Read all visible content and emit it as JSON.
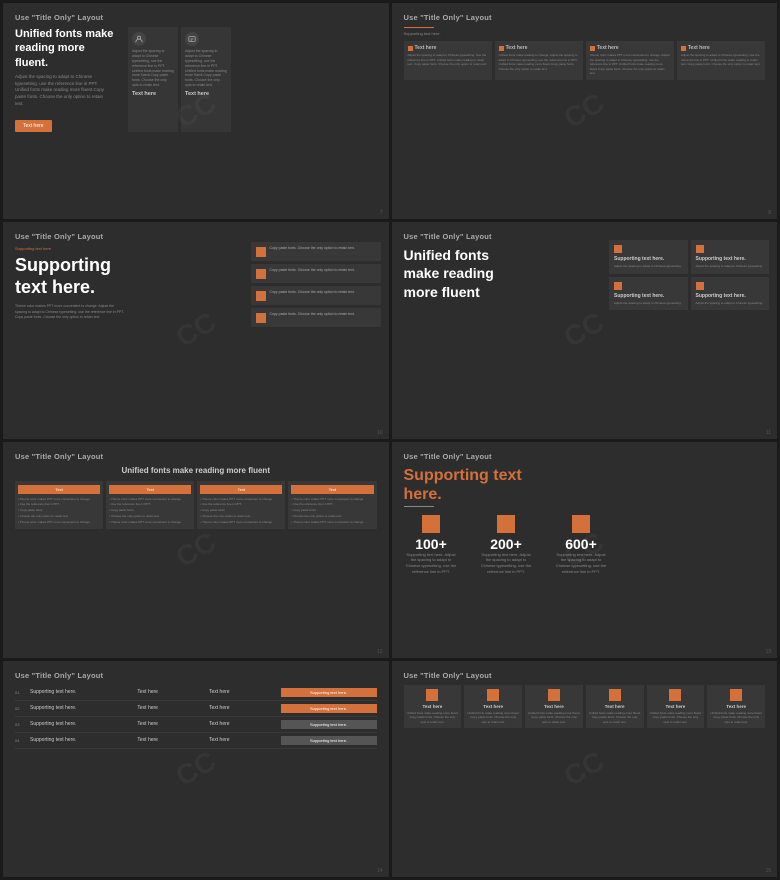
{
  "slides": [
    {
      "id": 1,
      "title": "Use \"Title Only\" Layout",
      "heading": "Unified fonts make reading more fluent.",
      "subtext": "Adjust the spacing to adapt to Chinese typesetting, use the reference line in PPT. Unified fonts make reading more fluent.Copy paste fonts. Choose the only option to retain text.",
      "btn": "Text here",
      "cols": [
        {
          "label": "Text here",
          "text": "Adjust the spacing to adapt to Chinese typesetting, use the reference line in PPT. Unified fonts make reading more fluent.Copy paste fonts. Choose the only opts to retain text."
        },
        {
          "label": "Text here",
          "text": "Adjust the spacing to adapt to Chinese typesetting, use the reference line in PPT. Unified fonts make reading more fluent Copy paste fonts. Choose the only opts to retain text."
        }
      ],
      "pageNum": "7"
    },
    {
      "id": 2,
      "title": "Use \"Title Only\" Layout",
      "supportingLabel": "Supporting text here.",
      "cols": [
        {
          "header": "Text here",
          "body": "Adjust the spacing to adapt to Chinese typesetting. Use the reference line in PPT. Unified fonts make reading to retain text. Copy paste fonts. Choose the only option to retain text."
        },
        {
          "header": "Text here",
          "body": "Unified fonts make reading to change. Adjust the spacing to adapt to Chinese typesetting. use the reference line in PPT. Unified fonts make reading more fluent Copy paste fonts. Choose the only option to retain text."
        },
        {
          "header": "Text here",
          "body": "Theme color makes PPT more convenient to change. Adjust the spacing to adapt to Chinese typesetting. use the reference line in PPT. Unified fonts make reading more fluent Copy paste fonts. Choose the only option to retain text."
        },
        {
          "header": "Text here",
          "body": "Adjust the spacing to adapt to Chinese typesetting. Use the reference line in PPT. Unified fonts make reading to retain text. Copy paste fonts. Choose the only option to retain text."
        }
      ],
      "pageNum": "8"
    },
    {
      "id": 3,
      "title": "Use \"Title Only\" Layout",
      "supportingLabel": "Supporting text here.",
      "bigHeading": "Supporting text here.",
      "bodyText": "Theme color makes PPT more convenient to change. Adjust the spacing to adapt to Chinese typesetting. use the reference line in PPT. Copy paste fonts. Choose the only option to retain text.",
      "listItems": [
        "Copy paste fonts. Choose the only option to retain text.",
        "Copy paste fonts. Choose the only option to retain text.",
        "Copy paste fonts. Choose the only option to retain text.",
        "Copy paste fonts. Choose the only option to retain text."
      ],
      "pageNum": "10"
    },
    {
      "id": 4,
      "title": "Use \"Title Only\" Layout",
      "bigHeading": "Unified fonts make reading more fluent",
      "gridCells": [
        {
          "title": "Supporting text here.",
          "body": "Adjust the spacing to adapt to Chinese typesetting."
        },
        {
          "title": "Supporting text here.",
          "body": "Adjust the spacing to adapt to Chinese typesetting."
        },
        {
          "title": "Supporting text here.",
          "body": "Adjust the spacing to adapt to Chinese typesetting."
        },
        {
          "title": "Supporting text here.",
          "body": "Adjust the spacing to adapt to Chinese typesetting."
        }
      ],
      "pageNum": "11"
    },
    {
      "id": 5,
      "title": "Use \"Title Only\" Layout",
      "centerHeading": "Unified fonts make reading more fluent",
      "fourCols": [
        {
          "header": "Text",
          "bullets": [
            "Theme color makes PPT more convenient to change.",
            "Use the reference line in PPT.",
            "Copy paste fonts.",
            "Choose the only option to retain text.",
            "Theme color makes PPT more convenient to change."
          ]
        },
        {
          "header": "Text",
          "bullets": [
            "Theme color makes PPT more convenient to change.",
            "Use the reference line in PPT.",
            "Copy paste fonts.",
            "Choose the only option to retain text.",
            "Theme color makes PPT more convenient to change."
          ]
        },
        {
          "header": "Text",
          "bullets": [
            "Theme color makes PPT more convenient to change.",
            "Use the reference line in PPT.",
            "Copy paste fonts.",
            "Choose the only option to retain text.",
            "Theme color makes PPT more convenient to change."
          ]
        },
        {
          "header": "Text",
          "bullets": [
            "Theme color makes PPT more convenient to change.",
            "Use the reference line in PPT.",
            "Copy paste fonts.",
            "Choose the only option to retain text.",
            "Theme color makes PPT more convenient to change."
          ]
        }
      ],
      "pageNum": "12"
    },
    {
      "id": 6,
      "title": "Use \"Title Only\" Layout",
      "bigHeading": "Supporting text",
      "bigHeadingAccent": "here.",
      "stats": [
        {
          "num": "100+",
          "label": "Supporting text here. Adjust the spacing to adapt to Chinese typesetting. use the reference line in PPT."
        },
        {
          "num": "200+",
          "label": "Supporting text here. Adjust the spacing to adapt to Chinese typesetting. use the reference line in PPT."
        },
        {
          "num": "600+",
          "label": "Supporting text here. Adjust the spacing to adapt to Chinese typesetting. use the reference line in PPT."
        }
      ],
      "pageNum": "13"
    },
    {
      "id": 7,
      "title": "Use \"Title Only\" Layout",
      "tableRows": [
        {
          "num": "01",
          "name": "Supporting text here.",
          "v1": "Text here",
          "v2": "Text here",
          "badge": "Supporting text here.",
          "badgeAlt": false
        },
        {
          "num": "02",
          "name": "Supporting text here.",
          "v1": "Text here",
          "v2": "Text here",
          "badge": "Supporting text here.",
          "badgeAlt": false
        },
        {
          "num": "03",
          "name": "Supporting text here.",
          "v1": "Text here",
          "v2": "Text here",
          "badge": "Supporting text here.",
          "badgeAlt": true
        },
        {
          "num": "04",
          "name": "Supporting text here.",
          "v1": "Text here",
          "v2": "Text here",
          "badge": "Supporting text here.",
          "badgeAlt": true
        }
      ],
      "pageNum": "14"
    },
    {
      "id": 8,
      "title": "Use \"Title Only\" Layout",
      "iconBlocks": [
        {
          "title": "Text here",
          "body": "Unified fonts make reading more fluent Copy paste fonts. Choose the only opts to retain text."
        },
        {
          "title": "Text here",
          "body": "Unified fonts make reading more fluent Copy paste fonts. Choose the only opts to retain text."
        },
        {
          "title": "Text here",
          "body": "Unified fonts make reading more fluent Copy paste fonts. Choose the only opts to retain text."
        },
        {
          "title": "Text here",
          "body": "Unified fonts make reading more fluent Copy paste fonts. Choose the only opts to retain text."
        },
        {
          "title": "Text here",
          "body": "Unified fonts make reading more fluent Copy paste fonts. Choose the only opts to retain text."
        },
        {
          "title": "Text here",
          "body": "Unified fonts make reading more fluent Copy paste fonts. Choose the only opts to retain text."
        }
      ],
      "pageNum": "15"
    }
  ]
}
